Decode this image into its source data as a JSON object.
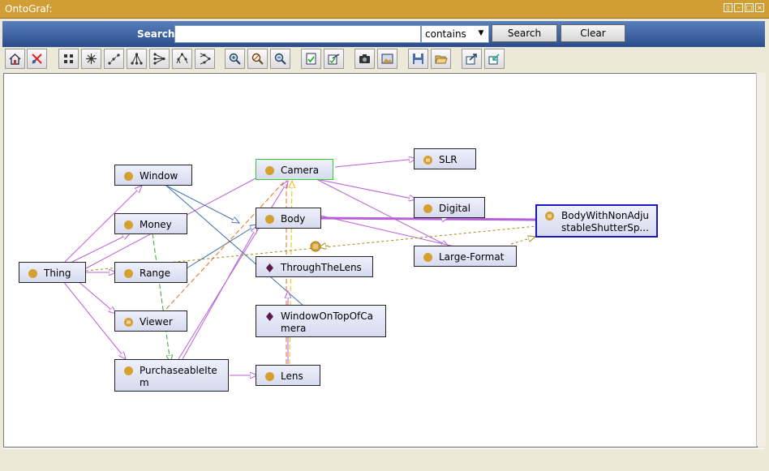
{
  "window": {
    "title": "OntoGraf:"
  },
  "search": {
    "label": "Search:",
    "value": "",
    "mode": "contains",
    "search_button": "Search",
    "clear_button": "Clear"
  },
  "toolbar": {
    "icons": [
      "home-icon",
      "remove-icon",
      "grid-layout-icon",
      "spring-layout-icon",
      "radial-layout-icon",
      "tree-layout-down-icon",
      "tree-layout-left-icon",
      "vertical-tree-icon",
      "horizontal-tree-icon",
      "zoom-in-icon",
      "zoom-reset-icon",
      "zoom-out-icon",
      "filter-nodes-icon",
      "filter-arcs-icon",
      "camera-icon",
      "image-icon",
      "save-icon",
      "open-icon",
      "export-icon",
      "import-icon"
    ]
  },
  "graph": {
    "nodes": [
      {
        "id": "thing",
        "label": "Thing",
        "type": "class"
      },
      {
        "id": "window",
        "label": "Window",
        "type": "class"
      },
      {
        "id": "money",
        "label": "Money",
        "type": "class"
      },
      {
        "id": "range",
        "label": "Range",
        "type": "class"
      },
      {
        "id": "viewer",
        "label": "Viewer",
        "type": "defined-class"
      },
      {
        "id": "purchaseable",
        "label": "PurchaseableIte\nm",
        "type": "class"
      },
      {
        "id": "camera",
        "label": "Camera",
        "type": "class"
      },
      {
        "id": "body",
        "label": "Body",
        "type": "class"
      },
      {
        "id": "throughthelens",
        "label": "ThroughTheLens",
        "type": "individual"
      },
      {
        "id": "windowontop",
        "label": "WindowOnTopOfCa\nmera",
        "type": "individual"
      },
      {
        "id": "lens",
        "label": "Lens",
        "type": "class"
      },
      {
        "id": "slr",
        "label": "SLR",
        "type": "defined-class"
      },
      {
        "id": "digital",
        "label": "Digital",
        "type": "class"
      },
      {
        "id": "largeformat",
        "label": "Large-Format",
        "type": "class"
      },
      {
        "id": "bodywithnonadj",
        "label": "BodyWithNonAdju\nstableShutterSp...",
        "type": "defined-class"
      }
    ]
  },
  "colors": {
    "subclass_arc": "#b860d8",
    "green_arc": "#33aa33",
    "orange_arc": "#e07020",
    "yellow_arc": "#e8c000",
    "blue_arc": "#4070b0",
    "olive_arc": "#a08a10",
    "class_icon": "#d4a030",
    "individual_icon": "#5a1a4a",
    "selected_border": "#1818c8"
  }
}
